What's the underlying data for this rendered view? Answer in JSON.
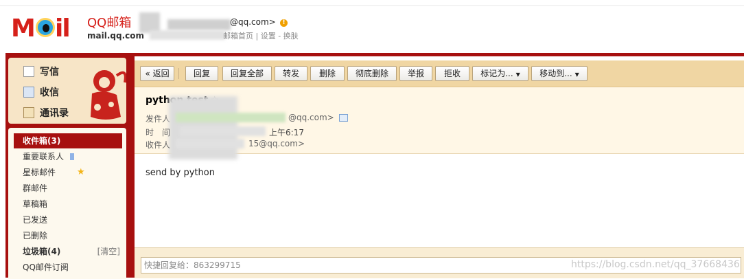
{
  "header": {
    "logo_mark": "MOil",
    "logo_cn": "QQ邮箱",
    "logo_en": "mail.qq.com",
    "account_email_suffix": "@qq.com>",
    "account_sub": "邮箱首页 | 设置 - 换肤"
  },
  "sidebar": {
    "quick": [
      {
        "label": "写信",
        "icon": "pencil-icon"
      },
      {
        "label": "收信",
        "icon": "inbox-icon"
      },
      {
        "label": "通讯录",
        "icon": "contacts-icon"
      }
    ],
    "folders": [
      {
        "label": "收件箱(3)",
        "active": true
      },
      {
        "label": "重要联系人",
        "icon": "bookmark-icon"
      },
      {
        "label": "星标邮件",
        "icon": "star-icon"
      },
      {
        "label": "群邮件"
      },
      {
        "label": "草稿箱"
      },
      {
        "label": "已发送"
      },
      {
        "label": "已删除"
      },
      {
        "label": "垃圾箱(4)",
        "bold": true,
        "action": "[清空]"
      },
      {
        "label": "QQ邮件订阅"
      }
    ]
  },
  "toolbar": {
    "back": "« 返回",
    "reply": "回复",
    "reply_all": "回复全部",
    "forward": "转发",
    "delete": "删除",
    "delete_permanent": "彻底删除",
    "report": "举报",
    "reject": "拒收",
    "mark_as": "标记为...",
    "move_to": "移动到..."
  },
  "mail": {
    "subject": "python test",
    "star": "☆",
    "from_label": "发件人",
    "from_suffix": "@qq.com>",
    "time_label": "时　间",
    "time_value": "上午6:17",
    "to_label": "收件人",
    "to_suffix": "15@qq.com>",
    "body": "send by python"
  },
  "quick_reply": {
    "placeholder": "快捷回复给：863299715"
  },
  "watermark": "https://blog.csdn.net/qq_37668436",
  "colors": {
    "brand_red": "#a7100f",
    "toolbar_bg": "#f0d6a3",
    "header_bg": "#fff7e6"
  }
}
